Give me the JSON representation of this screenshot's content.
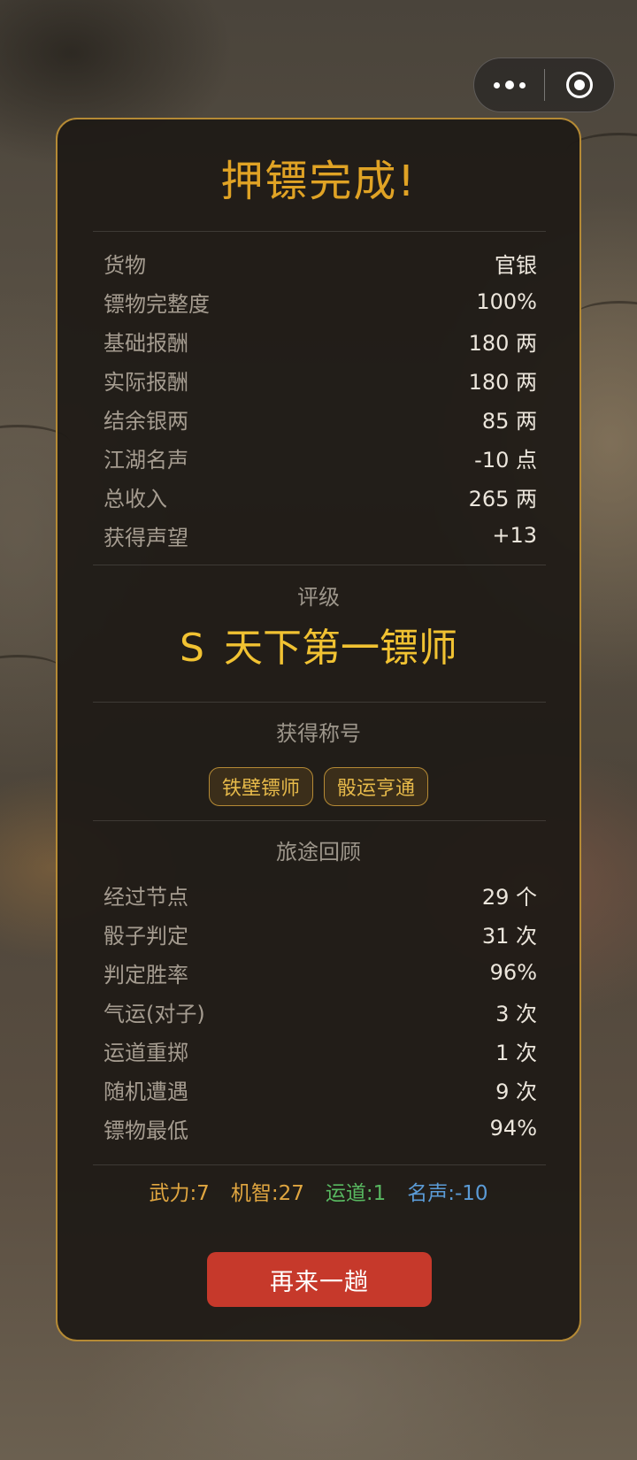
{
  "result": {
    "title": "押镖完成!",
    "summary": [
      {
        "label": "货物",
        "value": "官银"
      },
      {
        "label": "镖物完整度",
        "value": "100%"
      },
      {
        "label": "基础报酬",
        "value": "180 两"
      },
      {
        "label": "实际报酬",
        "value": "180 两"
      },
      {
        "label": "结余银两",
        "value": "85 两"
      },
      {
        "label": "江湖名声",
        "value": "-10 点"
      },
      {
        "label": "总收入",
        "value": "265 两"
      },
      {
        "label": "获得声望",
        "value": "+13"
      }
    ],
    "rating": {
      "label": "评级",
      "grade": "S",
      "title": "天下第一镖师",
      "color": "#f1c232"
    },
    "titles_earned": {
      "label": "获得称号",
      "items": [
        "铁壁镖师",
        "骰运亨通"
      ]
    },
    "journey": {
      "label": "旅途回顾",
      "stats": [
        {
          "label": "经过节点",
          "value": "29 个"
        },
        {
          "label": "骰子判定",
          "value": "31 次"
        },
        {
          "label": "判定胜率",
          "value": "96%"
        },
        {
          "label": "气运(对子)",
          "value": "3 次"
        },
        {
          "label": "运道重掷",
          "value": "1 次"
        },
        {
          "label": "随机遭遇",
          "value": "9 次"
        },
        {
          "label": "镖物最低",
          "value": "94%"
        }
      ]
    },
    "attributes": [
      {
        "label": "武力:7",
        "color": "#e0a640"
      },
      {
        "label": "机智:27",
        "color": "#e0a640"
      },
      {
        "label": "运道:1",
        "color": "#58b860"
      },
      {
        "label": "名声:-10",
        "color": "#5b9bd6"
      }
    ],
    "retry_label": "再来一趟",
    "accent_color": "#e0a325",
    "button_color": "#c6392b"
  },
  "capsule": {
    "more_icon": "more-dots-icon",
    "close_icon": "target-close-icon"
  }
}
